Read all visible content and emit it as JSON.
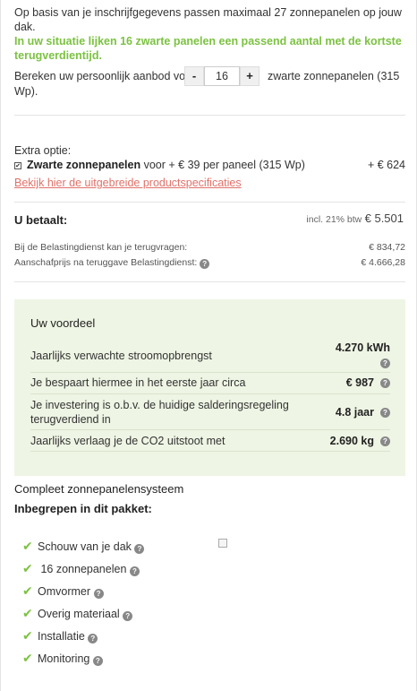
{
  "intro": {
    "line1": "Op basis van je inschrijfgegevens passen maximaal 27 zonnepanelen op jouw dak.",
    "line2": "In uw situatie lijken 16 zwarte panelen een passend aantal met de kortste terugverdientijd."
  },
  "calculator": {
    "label_before": "Bereken uw persoonlijk aanbod voor",
    "minus": "-",
    "quantity": "16",
    "plus": "+",
    "label_after": "zwarte zonnepanelen (315",
    "label_after2": "Wp)."
  },
  "extra": {
    "title": "Extra optie:",
    "checkbox_mark": "✔",
    "product_bold": "Zwarte zonnepanelen",
    "product_rest": " voor + € 39 per paneel (315 Wp)",
    "price": "+ € 624",
    "link": "Bekijk hier de uitgebreide productspecificaties"
  },
  "payment": {
    "label": "U betaalt:",
    "vat_note": "incl. 21% btw",
    "total": "€ 5.501",
    "refund_label": "Bij de Belastingdienst kan je terugvragen:",
    "refund_value": "€ 834,72",
    "net_label": "Aanschafprijs na teruggave Belastingdienst:",
    "net_value": "€ 4.666,28"
  },
  "benefit": {
    "title": "Uw voordeel",
    "rows": [
      {
        "label": "Jaarlijks verwachte stroomopbrengst",
        "value": "4.270 kWh"
      },
      {
        "label": "Je bespaart hiermee in het eerste jaar circa",
        "value": "€ 987"
      },
      {
        "label": "Je investering is o.b.v. de huidige salderingsregeling terugverdiend in",
        "value": "4.8 jaar"
      },
      {
        "label": "Jaarlijks verlaag je de CO2 uitstoot met",
        "value": "2.690 kg"
      }
    ]
  },
  "package": {
    "title": "Compleet zonnepanelensysteem",
    "included": "Inbegrepen in dit pakket:",
    "items": [
      "Schouw van je dak",
      " 16 zonnepanelen",
      "Omvormer",
      "Overig materiaal",
      "Installatie",
      "Monitoring"
    ]
  },
  "icons": {
    "help": "question-circle-icon",
    "check": "checkmark-icon"
  },
  "colors": {
    "accent_green": "#7cc242",
    "link_red": "#e0726a",
    "benefit_bg": "#eef5e4"
  }
}
